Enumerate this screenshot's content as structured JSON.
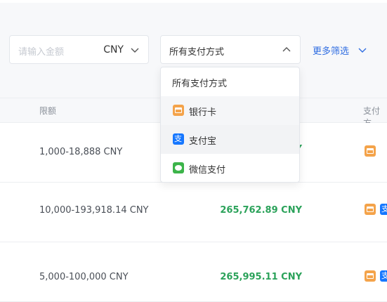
{
  "filters": {
    "amount_placeholder": "请输入金额",
    "currency": "CNY",
    "payment_select_value": "所有支付方式",
    "more_filters": "更多筛选"
  },
  "dropdown": {
    "options": [
      {
        "label": "所有支付方式",
        "icon": ""
      },
      {
        "label": "银行卡",
        "icon": "bank-card-icon"
      },
      {
        "label": "支付宝",
        "icon": "alipay-icon"
      },
      {
        "label": "微信支付",
        "icon": "wechat-pay-icon"
      }
    ]
  },
  "table": {
    "headers": {
      "limit": "限额",
      "payment_methods": "支付方"
    },
    "rows": [
      {
        "limit": "1,000-18,888 CNY",
        "amount": "",
        "methods": [
          "bank-card-icon"
        ]
      },
      {
        "limit": "10,000-193,918.14 CNY",
        "amount": "265,762.89 CNY",
        "methods": [
          "bank-card-icon",
          "alipay-icon"
        ]
      },
      {
        "limit": "5,000-100,000 CNY",
        "amount": "265,995.11 CNY",
        "methods": [
          "bank-card-icon",
          "alipay-icon"
        ]
      }
    ],
    "partial_visible_text": "Y"
  },
  "colors": {
    "accent_blue": "#2f6de1",
    "amount_green": "#2ba25a",
    "bank_orange": "#f4a34a",
    "alipay_blue": "#1677ff",
    "wechat_green": "#3cb44a"
  }
}
